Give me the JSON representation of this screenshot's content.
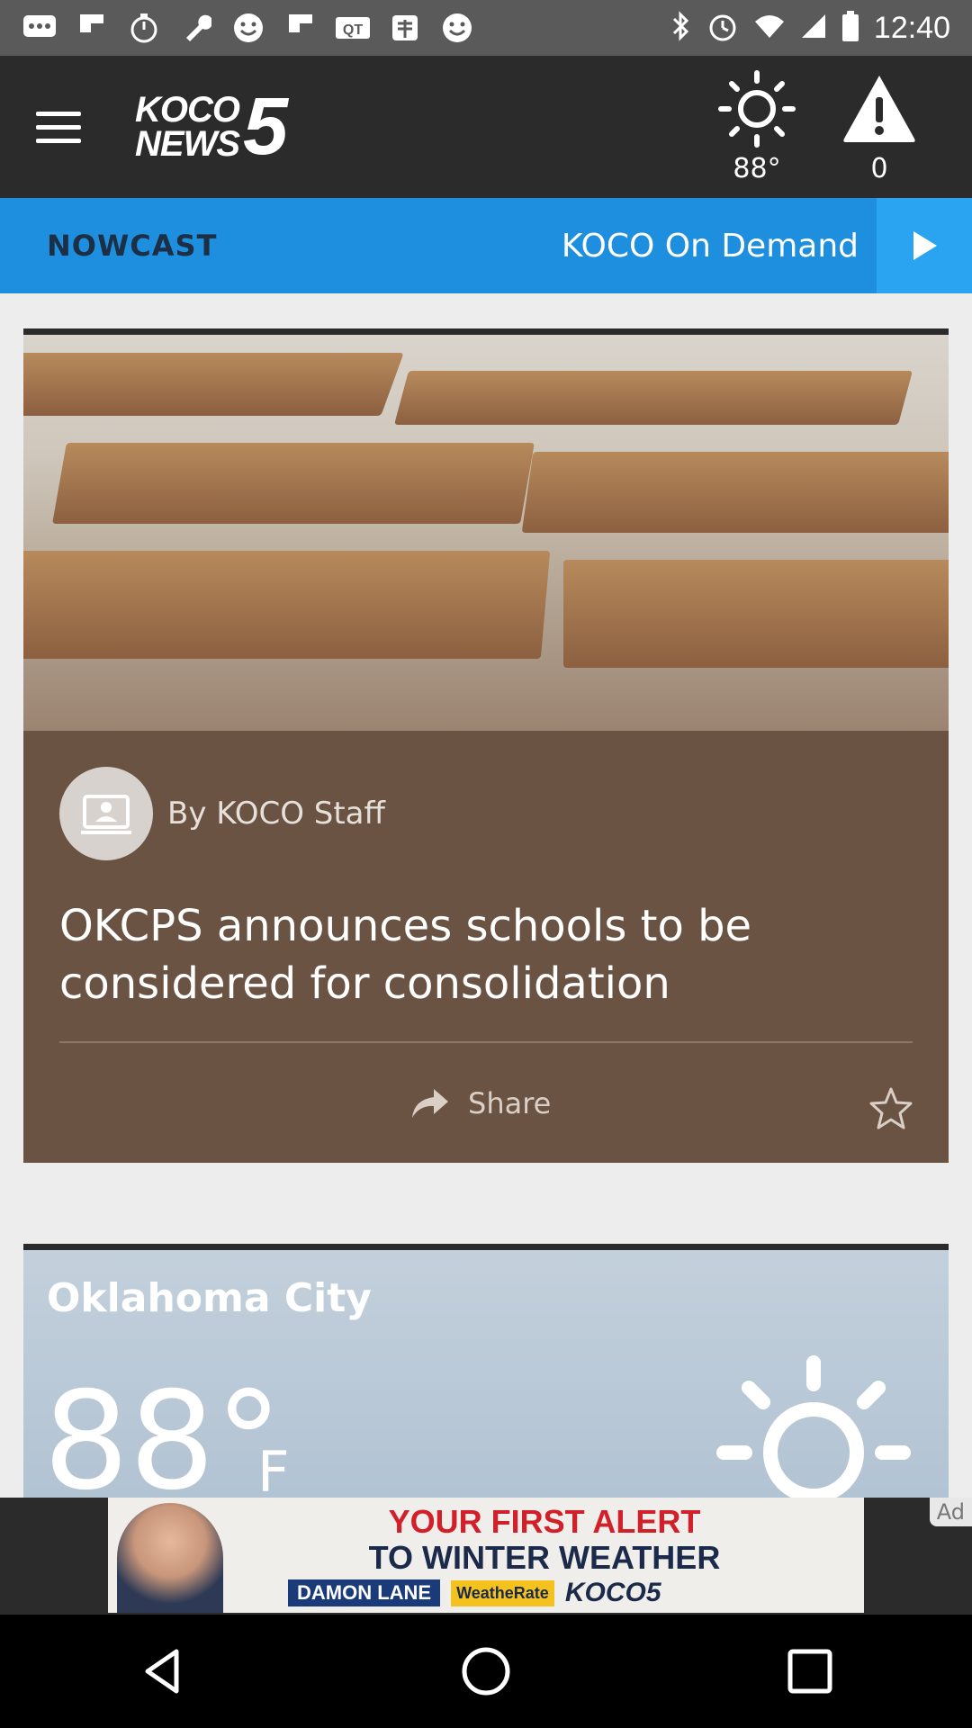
{
  "status_bar": {
    "time": "12:40",
    "left_icons": [
      "chat-icon",
      "flipboard-icon",
      "timer-icon",
      "wrench-icon",
      "smiley-icon",
      "flipboard-icon",
      "qt-icon",
      "chinese-app-icon",
      "smiley-icon"
    ],
    "right_icons": [
      "bluetooth-icon",
      "alarm-icon",
      "wifi-icon",
      "signal-icon",
      "battery-icon"
    ]
  },
  "app_bar": {
    "logo_line1": "KOCO",
    "logo_line2": "NEWS",
    "logo_number": "5",
    "weather_temp": "88°",
    "alerts_count": "0"
  },
  "nav": {
    "nowcast": "NOWCAST",
    "on_demand": "KOCO On Demand"
  },
  "article": {
    "author": "By KOCO Staff",
    "headline": "OKCPS announces schools to be considered for consolidation",
    "share_label": "Share"
  },
  "weather": {
    "city": "Oklahoma City",
    "temp": "88°",
    "unit": "F"
  },
  "ad": {
    "line1": "YOUR FIRST ALERT",
    "line2": "TO WINTER WEATHER",
    "name": "DAMON LANE",
    "rate": "WeatheRate",
    "brand": "KOCO5",
    "label": "Ad"
  },
  "colors": {
    "nav_blue": "#1e8fde",
    "app_bar": "#2b2b2b",
    "card_brown": "#6b5343"
  }
}
